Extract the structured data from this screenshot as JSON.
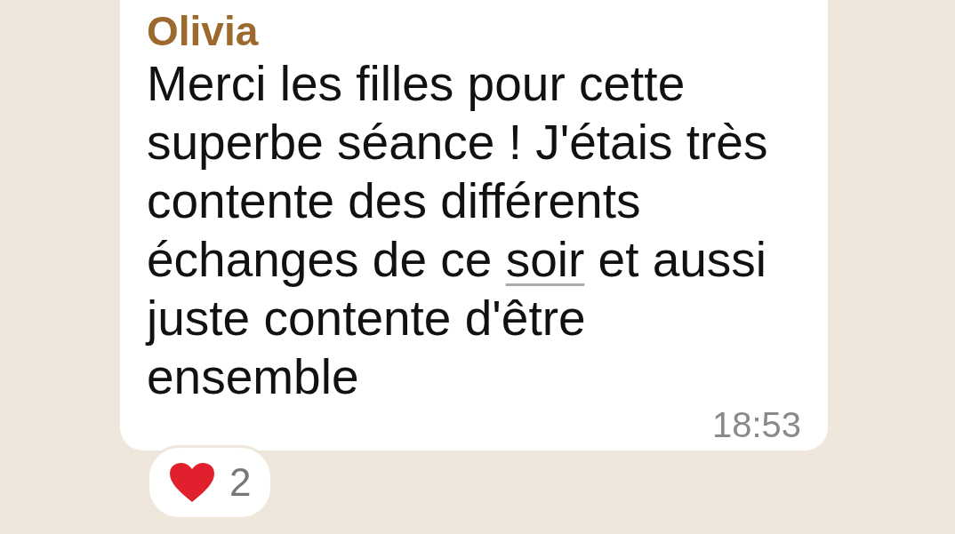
{
  "message": {
    "sender": "Olivia",
    "text_before": "Merci les filles pour cette superbe séance ! J'étais très contente des différents échanges de ce ",
    "link": "soir",
    "text_after": " et aussi juste contente d'être ensemble",
    "time": "18:53"
  },
  "reaction": {
    "count": "2"
  }
}
